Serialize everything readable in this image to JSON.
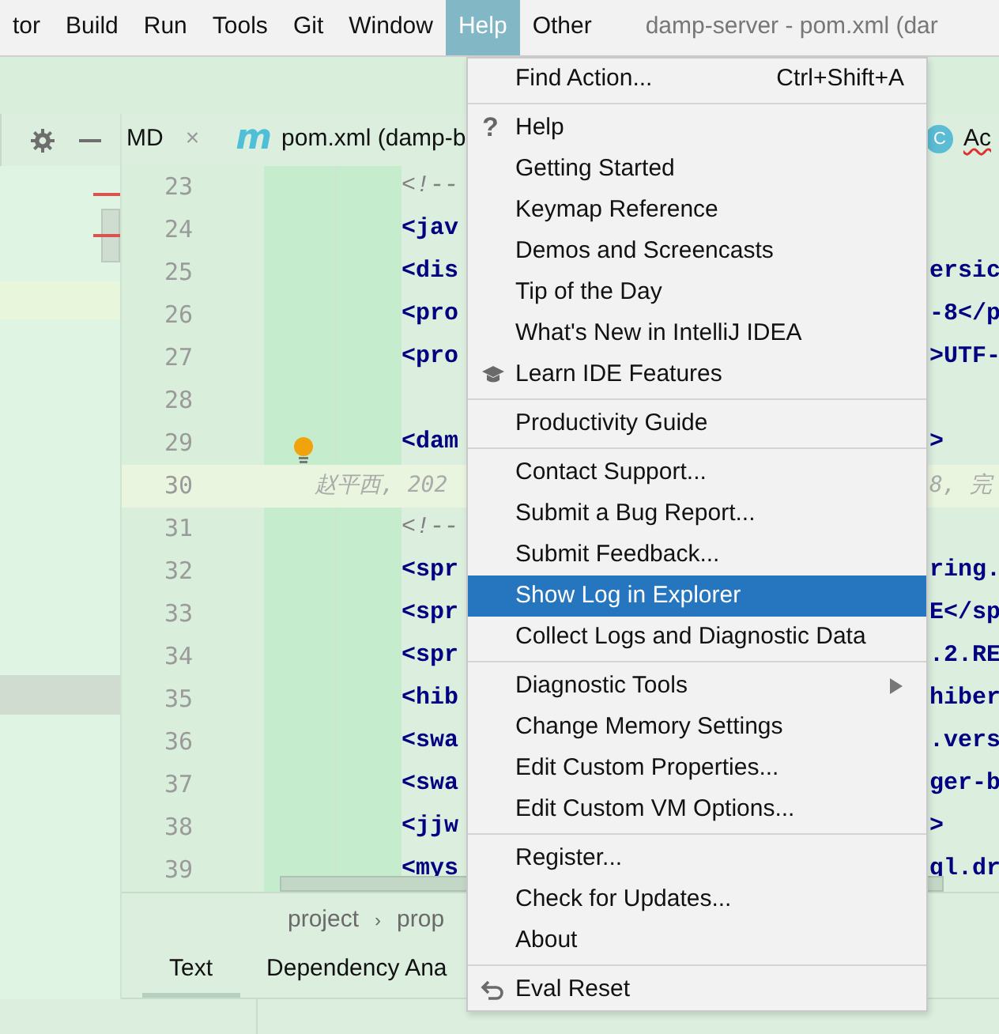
{
  "menubar": {
    "items": [
      {
        "label": "tor",
        "selected": false
      },
      {
        "label": "Build",
        "selected": false
      },
      {
        "label": "Run",
        "selected": false
      },
      {
        "label": "Tools",
        "selected": false
      },
      {
        "label": "Git",
        "selected": false
      },
      {
        "label": "Window",
        "selected": false
      },
      {
        "label": "Help",
        "selected": true
      },
      {
        "label": "Other",
        "selected": false
      }
    ],
    "title": "damp-server - pom.xml (dar"
  },
  "editor_tabs": [
    {
      "label": "MD",
      "close": "×"
    },
    {
      "icon_text": "m",
      "label": "pom.xml (damp-b"
    },
    {
      "icon_text": "C",
      "label": "Ac",
      "error": true
    }
  ],
  "editor": {
    "lines": [
      {
        "number": "23",
        "kind": "comment",
        "code": "<!--"
      },
      {
        "number": "24",
        "kind": "tag",
        "code": "<jav"
      },
      {
        "number": "25",
        "kind": "tag",
        "code": "<dis",
        "right": "ersic"
      },
      {
        "number": "26",
        "kind": "tag",
        "code": "<pro",
        "right": "-8</p"
      },
      {
        "number": "27",
        "kind": "tag",
        "code": "<pro",
        "right": ">UTF-"
      },
      {
        "number": "28",
        "kind": "empty"
      },
      {
        "number": "29",
        "kind": "tag",
        "code": "<dam",
        "right": ">",
        "bulb": true
      },
      {
        "number": "30",
        "kind": "blame",
        "code": "赵平西, 202",
        "right": "8, 完"
      },
      {
        "number": "31",
        "kind": "comment",
        "code": "<!--"
      },
      {
        "number": "32",
        "kind": "tag",
        "code": "<spr",
        "right": "ring."
      },
      {
        "number": "33",
        "kind": "tag",
        "code": "<spr",
        "right": "E</sp"
      },
      {
        "number": "34",
        "kind": "tag",
        "code": "<spr",
        "right": ".2.RE"
      },
      {
        "number": "35",
        "kind": "tag",
        "code": "<hib",
        "right": "hiber"
      },
      {
        "number": "36",
        "kind": "tag",
        "code": "<swa",
        "right": ".vers"
      },
      {
        "number": "37",
        "kind": "tag",
        "code": "<swa",
        "right": "ger-b"
      },
      {
        "number": "38",
        "kind": "tag",
        "code": "<jjw",
        "right": ">"
      },
      {
        "number": "39",
        "kind": "tag",
        "code": "<mys",
        "right": "ql.dr"
      }
    ]
  },
  "breadcrumbs": {
    "items": [
      "project",
      "prop"
    ],
    "separator": "›"
  },
  "bottom_tabs": [
    {
      "label": "Text",
      "selected": true
    },
    {
      "label": "Dependency Ana",
      "selected": false
    }
  ],
  "help_menu": {
    "items": [
      {
        "kind": "item",
        "label": "Find Action...",
        "shortcut": "Ctrl+Shift+A",
        "selected": false
      },
      {
        "kind": "separator"
      },
      {
        "kind": "item",
        "icon_text": "?",
        "label": "Help",
        "selected": false
      },
      {
        "kind": "item",
        "label": "Getting Started",
        "selected": false
      },
      {
        "kind": "item",
        "label": "Keymap Reference",
        "selected": false
      },
      {
        "kind": "item",
        "label": "Demos and Screencasts",
        "selected": false
      },
      {
        "kind": "item",
        "label": "Tip of the Day",
        "selected": false
      },
      {
        "kind": "item",
        "label": "What's New in IntelliJ IDEA",
        "selected": false
      },
      {
        "kind": "learning",
        "label": "Learn IDE Features",
        "selected": false
      },
      {
        "kind": "separator"
      },
      {
        "kind": "item",
        "label": "Productivity Guide",
        "selected": false
      },
      {
        "kind": "separator"
      },
      {
        "kind": "item",
        "label": "Contact Support...",
        "selected": false
      },
      {
        "kind": "item",
        "label": "Submit a Bug Report...",
        "selected": false
      },
      {
        "kind": "item",
        "label": "Submit Feedback...",
        "selected": false
      },
      {
        "kind": "item",
        "label": "Show Log in Explorer",
        "selected": true
      },
      {
        "kind": "item",
        "label": "Collect Logs and Diagnostic Data",
        "selected": false
      },
      {
        "kind": "separator"
      },
      {
        "kind": "item",
        "label": "Diagnostic Tools",
        "submenu": true,
        "selected": false
      },
      {
        "kind": "item",
        "label": "Change Memory Settings",
        "selected": false
      },
      {
        "kind": "item",
        "label": "Edit Custom Properties...",
        "selected": false
      },
      {
        "kind": "item",
        "label": "Edit Custom VM Options...",
        "selected": false
      },
      {
        "kind": "separator"
      },
      {
        "kind": "item",
        "label": "Register...",
        "selected": false
      },
      {
        "kind": "item",
        "label": "Check for Updates...",
        "selected": false
      },
      {
        "kind": "item",
        "label": "About",
        "selected": false
      },
      {
        "kind": "separator"
      },
      {
        "kind": "reset",
        "label": "Eval Reset",
        "selected": false
      }
    ]
  }
}
